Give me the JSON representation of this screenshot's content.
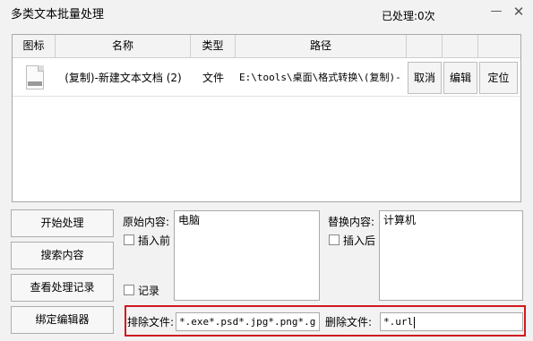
{
  "window": {
    "title": "多类文本批量处理",
    "processed_status": "已处理:0次",
    "minimize_glyph": "—",
    "close_glyph": "✕"
  },
  "table": {
    "columns": [
      "图标",
      "名称",
      "类型",
      "路径",
      "",
      "",
      ""
    ],
    "rows": [
      {
        "icon": "docx-file-icon",
        "name": "(复制)-新建文本文档 (2)",
        "type": "文件",
        "path": "E:\\tools\\桌面\\格式转换\\(复制)-",
        "actions": [
          "取消",
          "编辑",
          "定位"
        ]
      }
    ]
  },
  "buttons": {
    "start": "开始处理",
    "search": "搜索内容",
    "log": "查看处理记录",
    "bind_editor": "绑定编辑器"
  },
  "original": {
    "label": "原始内容:",
    "value": "电脑",
    "insert_before_label": "插入前",
    "insert_before_checked": false,
    "record_label": "记录",
    "record_checked": false
  },
  "replace": {
    "label": "替换内容:",
    "value": "计算机",
    "insert_after_label": "插入后",
    "insert_after_checked": false
  },
  "exclude": {
    "label": "排除文件:",
    "value": "*.exe*.psd*.jpg*.png*.g"
  },
  "delete": {
    "label": "删除文件:",
    "value": "*.url"
  },
  "colors": {
    "highlight_border": "#d0191f",
    "window_bg": "#f2f2f2"
  }
}
